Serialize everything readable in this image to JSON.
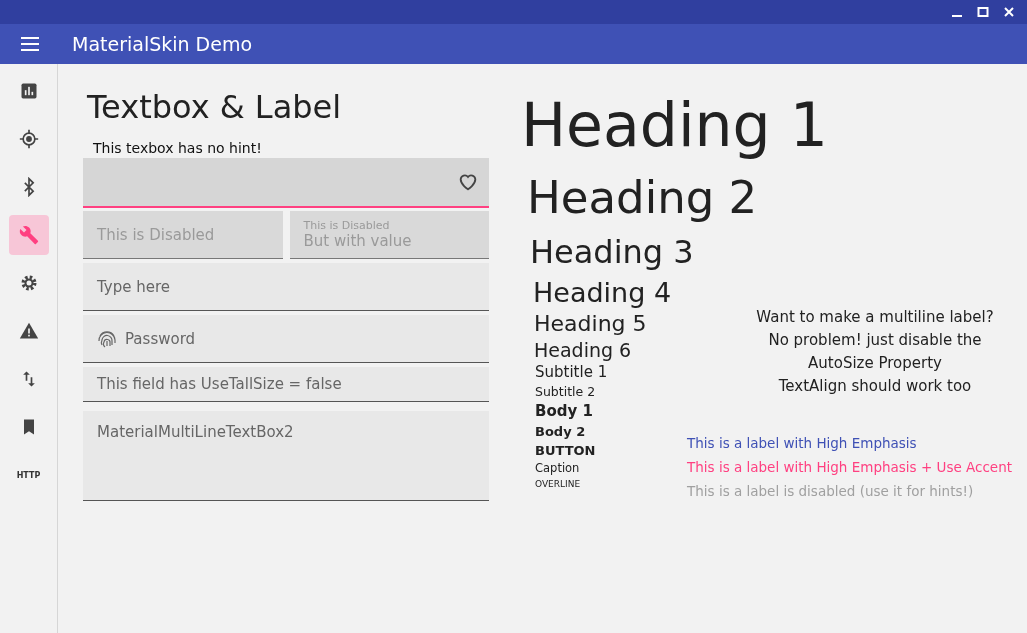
{
  "app_bar": {
    "title": "MaterialSkin Demo"
  },
  "nav_items": [
    {
      "kind": "chart",
      "selected": false
    },
    {
      "kind": "target",
      "selected": false
    },
    {
      "kind": "bluetooth",
      "selected": false
    },
    {
      "kind": "wrench",
      "selected": true
    },
    {
      "kind": "gear",
      "selected": false
    },
    {
      "kind": "warning",
      "selected": false
    },
    {
      "kind": "arrows",
      "selected": false
    },
    {
      "kind": "bookmark",
      "selected": false
    },
    {
      "kind": "text",
      "label": "HTTP",
      "selected": false
    }
  ],
  "page_title": "Textbox & Label",
  "no_hint_label": "This texbox has no hint!",
  "focused_field": {
    "focused": true
  },
  "disabled_fields": [
    {
      "placeholder": "This is Disabled",
      "disabled": true
    },
    {
      "hint": "This is Disabled",
      "value": "But with value",
      "disabled": true
    }
  ],
  "type_field": {
    "placeholder": "Type here"
  },
  "password_field": {
    "placeholder": "Password"
  },
  "short_field": {
    "placeholder": "This field has UseTallSize = false"
  },
  "multiline_field": {
    "value": "MaterialMultiLineTextBox2"
  },
  "big_headings": [
    {
      "kind": "h1",
      "text": "Heading 1"
    },
    {
      "kind": "h2",
      "text": "Heading 2"
    },
    {
      "kind": "h3",
      "text": "Heading 3"
    }
  ],
  "type_samples": [
    {
      "kind": "h4",
      "text": "Heading 4"
    },
    {
      "kind": "h5",
      "text": "Heading 5"
    },
    {
      "kind": "h6",
      "text": "Heading 6"
    },
    {
      "kind": "subtitle1",
      "text": "Subtitle 1"
    },
    {
      "kind": "subtitle2",
      "text": "Subtitle 2"
    },
    {
      "kind": "body1",
      "text": "Body 1"
    },
    {
      "kind": "body2",
      "text": "Body 2"
    },
    {
      "kind": "button",
      "text": "BUTTON"
    },
    {
      "kind": "caption",
      "text": "Caption"
    },
    {
      "kind": "overline",
      "text": "OVERLINE"
    }
  ],
  "multiline_label": [
    "Want to make a multiline label?",
    "No problem! just disable the",
    "AutoSize Property",
    "TextAlign should work too"
  ],
  "emphasis_labels": [
    {
      "kind": "high",
      "text": "This is a label with High Emphasis"
    },
    {
      "kind": "accent",
      "text": "This is a label with High Emphasis + Use Accent"
    },
    {
      "kind": "disabled",
      "text": "This is a label is disabled (use it for hints!)"
    }
  ]
}
